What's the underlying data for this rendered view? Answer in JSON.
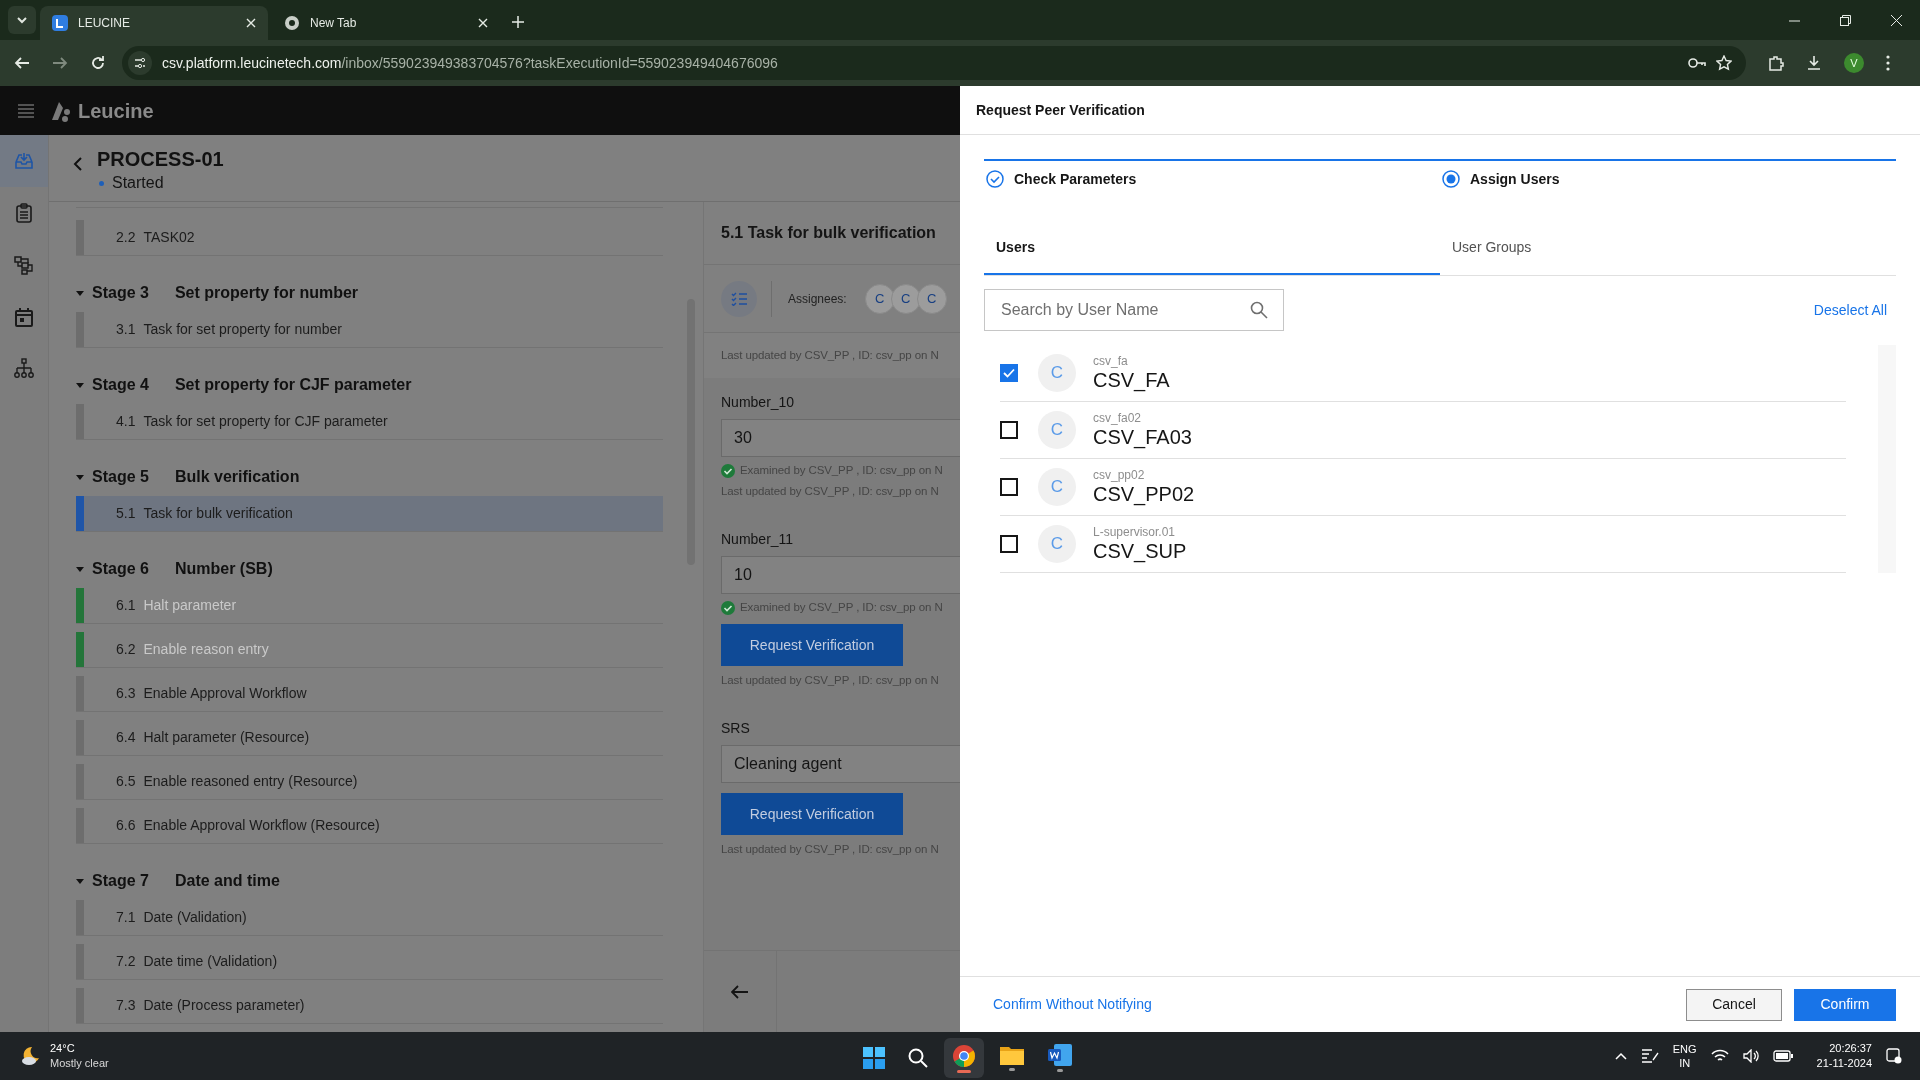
{
  "browser": {
    "tabs": [
      {
        "title": "LEUCINE",
        "selected": true,
        "kind": "app"
      },
      {
        "title": "New Tab",
        "selected": false,
        "kind": "newtab"
      }
    ],
    "url_host": "csv.platform.leucinetech.com",
    "url_path": "/inbox/559023949383704576?taskExecutionId=559023949404676096",
    "profile": "V"
  },
  "app": {
    "brand": "Leucine",
    "nav_rail": [
      {
        "kind": "inbox",
        "selected": true
      },
      {
        "kind": "checklist",
        "selected": false
      },
      {
        "kind": "flow",
        "selected": false
      },
      {
        "kind": "calendar",
        "selected": false
      },
      {
        "kind": "hierarchy",
        "selected": false
      }
    ],
    "process": {
      "title": "PROCESS-01",
      "status": "Started"
    }
  },
  "task_list": [
    {
      "tasks": [
        {
          "number": "2.2",
          "title": "TASK02",
          "completed": false,
          "selected": false
        }
      ]
    },
    {
      "label": "Stage 3",
      "title": "Set property for number",
      "tasks": [
        {
          "number": "3.1",
          "title": "Task for set property for number",
          "completed": false,
          "selected": false
        }
      ]
    },
    {
      "label": "Stage 4",
      "title": "Set property for CJF parameter",
      "tasks": [
        {
          "number": "4.1",
          "title": "Task for set property for CJF parameter",
          "completed": false,
          "selected": false
        }
      ]
    },
    {
      "label": "Stage 5",
      "title": "Bulk verification",
      "tasks": [
        {
          "number": "5.1",
          "title": "Task for bulk verification",
          "completed": false,
          "selected": true
        }
      ]
    },
    {
      "label": "Stage 6",
      "title": "Number (SB)",
      "tasks": [
        {
          "number": "6.1",
          "title": "Halt parameter",
          "completed": true,
          "selected": false
        },
        {
          "number": "6.2",
          "title": "Enable reason entry",
          "completed": true,
          "selected": false
        },
        {
          "number": "6.3",
          "title": "Enable Approval Workflow",
          "completed": false,
          "selected": false
        },
        {
          "number": "6.4",
          "title": "Halt parameter (Resource)",
          "completed": false,
          "selected": false
        },
        {
          "number": "6.5",
          "title": "Enable reasoned entry (Resource)",
          "completed": false,
          "selected": false
        },
        {
          "number": "6.6",
          "title": "Enable Approval Workflow (Resource)",
          "completed": false,
          "selected": false
        }
      ]
    },
    {
      "label": "Stage 7",
      "title": "Date and time",
      "tasks": [
        {
          "number": "7.1",
          "title": "Date (Validation)",
          "completed": false,
          "selected": false
        },
        {
          "number": "7.2",
          "title": "Date time (Validation)",
          "completed": false,
          "selected": false
        },
        {
          "number": "7.3",
          "title": "Date (Process parameter)",
          "completed": false,
          "selected": false
        }
      ]
    }
  ],
  "task_panel": {
    "title": "5.1 Task for bulk verification",
    "assignees_label": "Assignees:",
    "assignees": [
      "C",
      "C",
      "C"
    ],
    "last_updated": "Last updated by CSV_PP , ID: csv_pp on N",
    "parameters": [
      {
        "label": "Number_10",
        "value": "30",
        "notes": [
          {
            "kind": "examined",
            "text": "Examined by CSV_PP , ID: csv_pp on N"
          },
          {
            "kind": "updated",
            "text": "Last updated by CSV_PP , ID: csv_pp on N"
          }
        ]
      },
      {
        "label": "Number_11",
        "value": "10",
        "notes": [
          {
            "kind": "examined",
            "text": "Examined by CSV_PP , ID: csv_pp on N"
          },
          {
            "kind": "button",
            "text": "Request Verification"
          },
          {
            "kind": "updated",
            "text": "Last updated by CSV_PP , ID: csv_pp on N"
          }
        ]
      },
      {
        "label": "SRS",
        "value": "Cleaning agent",
        "notes": [
          {
            "kind": "button",
            "text": "Request Verification"
          },
          {
            "kind": "updated",
            "text": "Last updated by CSV_PP , ID: csv_pp on N"
          }
        ]
      }
    ]
  },
  "modal": {
    "title": "Request Peer Verification",
    "steps": [
      {
        "label": "Check Parameters",
        "completed": true
      },
      {
        "label": "Assign Users",
        "completed": false
      }
    ],
    "tabs": [
      {
        "label": "Users",
        "selected": true
      },
      {
        "label": "User Groups",
        "selected": false
      }
    ],
    "search": {
      "placeholder": "Search by User Name"
    },
    "deselect": "Deselect All",
    "users": [
      {
        "initial": "C",
        "username": "csv_fa",
        "name": "CSV_FA",
        "checked": true
      },
      {
        "initial": "C",
        "username": "csv_fa02",
        "name": "CSV_FA03",
        "checked": false
      },
      {
        "initial": "C",
        "username": "csv_pp02",
        "name": "CSV_PP02",
        "checked": false
      },
      {
        "initial": "C",
        "username": "L-supervisor.01",
        "name": "CSV_SUP",
        "checked": false
      }
    ],
    "link": "Confirm Without Notifying",
    "cancel": "Cancel",
    "confirm": "Confirm"
  },
  "taskbar": {
    "temperature": "24°C",
    "condition": "Mostly clear",
    "lang": "ENG",
    "region": "IN",
    "time": "20:26:37",
    "date": "21-11-2024"
  }
}
